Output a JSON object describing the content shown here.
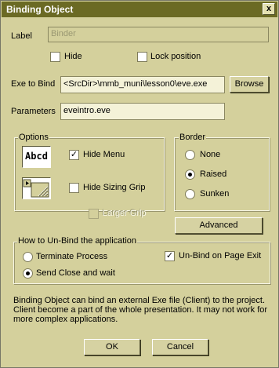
{
  "window": {
    "title": "Binding Object",
    "close_glyph": "x"
  },
  "label_field": {
    "label": "Label",
    "value": "Binder"
  },
  "checkboxes": {
    "hide": {
      "label": "Hide",
      "checked": false
    },
    "lock_position": {
      "label": "Lock position",
      "checked": false
    }
  },
  "exe": {
    "label": "Exe to Bind",
    "value": "<SrcDir>\\mmb_muni\\lesson0\\eve.exe",
    "browse_label": "Browse"
  },
  "params": {
    "label": "Parameters",
    "value": "eveintro.eve"
  },
  "options": {
    "title": "Options",
    "preview_text": "Abcd",
    "hide_menu": {
      "label": "Hide Menu",
      "checked": true
    },
    "hide_sizing_grip": {
      "label": "Hide Sizing Grip",
      "checked": false
    },
    "larger_grip": {
      "label": "Larger Grip",
      "checked": false,
      "enabled": false
    }
  },
  "border": {
    "title": "Border",
    "none": "None",
    "raised": "Raised",
    "sunken": "Sunken",
    "selected": "Raised",
    "advanced_label": "Advanced"
  },
  "unbind": {
    "title": "How to Un-Bind the application",
    "terminate": "Terminate Process",
    "send_close": "Send Close and wait",
    "selected": "Send Close and wait",
    "on_page_exit": {
      "label": "Un-Bind on Page Exit",
      "checked": true
    }
  },
  "description": "Binding Object can bind an external Exe file (Client) to the project. Client become a part of the whole presentation. It may not work for more complex applications.",
  "footer": {
    "ok": "OK",
    "cancel": "Cancel"
  },
  "colors": {
    "dialog_bg": "#d4d09c",
    "titlebar": "#6b6a24",
    "field_bg": "#f4f2d8"
  }
}
